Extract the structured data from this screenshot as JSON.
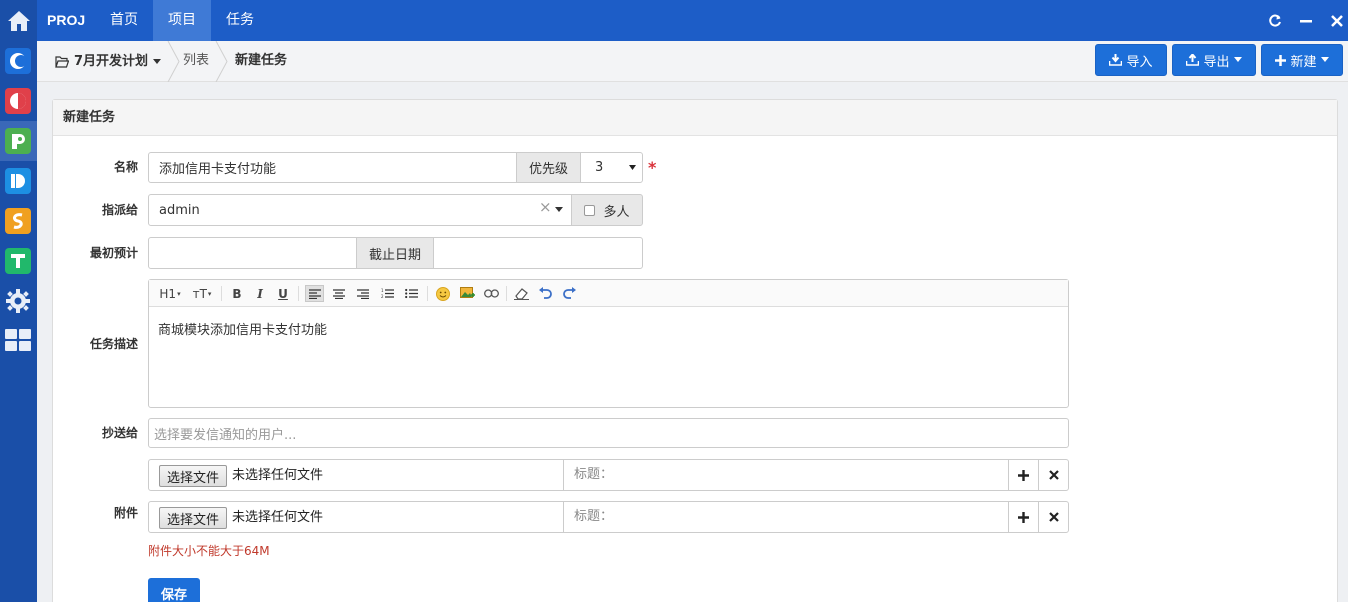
{
  "topnav": {
    "brand": "PROJ",
    "items": [
      {
        "label": "首页",
        "active": false
      },
      {
        "label": "项目",
        "active": true
      },
      {
        "label": "任务",
        "active": false
      }
    ]
  },
  "breadcrumb": {
    "project": "7月开发计划",
    "list": "列表",
    "current": "新建任务"
  },
  "toolbar": {
    "import_label": "导入",
    "export_label": "导出",
    "new_label": "新建"
  },
  "apps": [
    {
      "name": "C",
      "color": "#1d6fd9"
    },
    {
      "name": "◐",
      "color": "#e0404a"
    },
    {
      "name": "P",
      "color": "#4caf50"
    },
    {
      "name": "D",
      "color": "#1d8fe3"
    },
    {
      "name": "S",
      "color": "#f0a020"
    },
    {
      "name": "T",
      "color": "#21b86b"
    }
  ],
  "form": {
    "title": "新建任务",
    "name_label": "名称",
    "name_value": "添加信用卡支付功能",
    "priority_label": "优先级",
    "priority_value": "3",
    "assign_label": "指派给",
    "assign_value": "admin",
    "multi_label": "多人",
    "estimate_label": "最初预计",
    "estimate_value": "",
    "deadline_label": "截止日期",
    "deadline_value": "",
    "desc_label": "任务描述",
    "desc_value": "商城模块添加信用卡支付功能",
    "cc_label": "抄送给",
    "cc_placeholder": "选择要发信通知的用户...",
    "attach_label": "附件",
    "choose_file": "选择文件",
    "no_file": "未选择任何文件",
    "file_title_placeholder": "标题：",
    "attach_hint": "附件大小不能大于64M",
    "save_label": "保存"
  },
  "editor_toolbar": [
    "H1",
    "тT",
    "B",
    "I",
    "U"
  ]
}
